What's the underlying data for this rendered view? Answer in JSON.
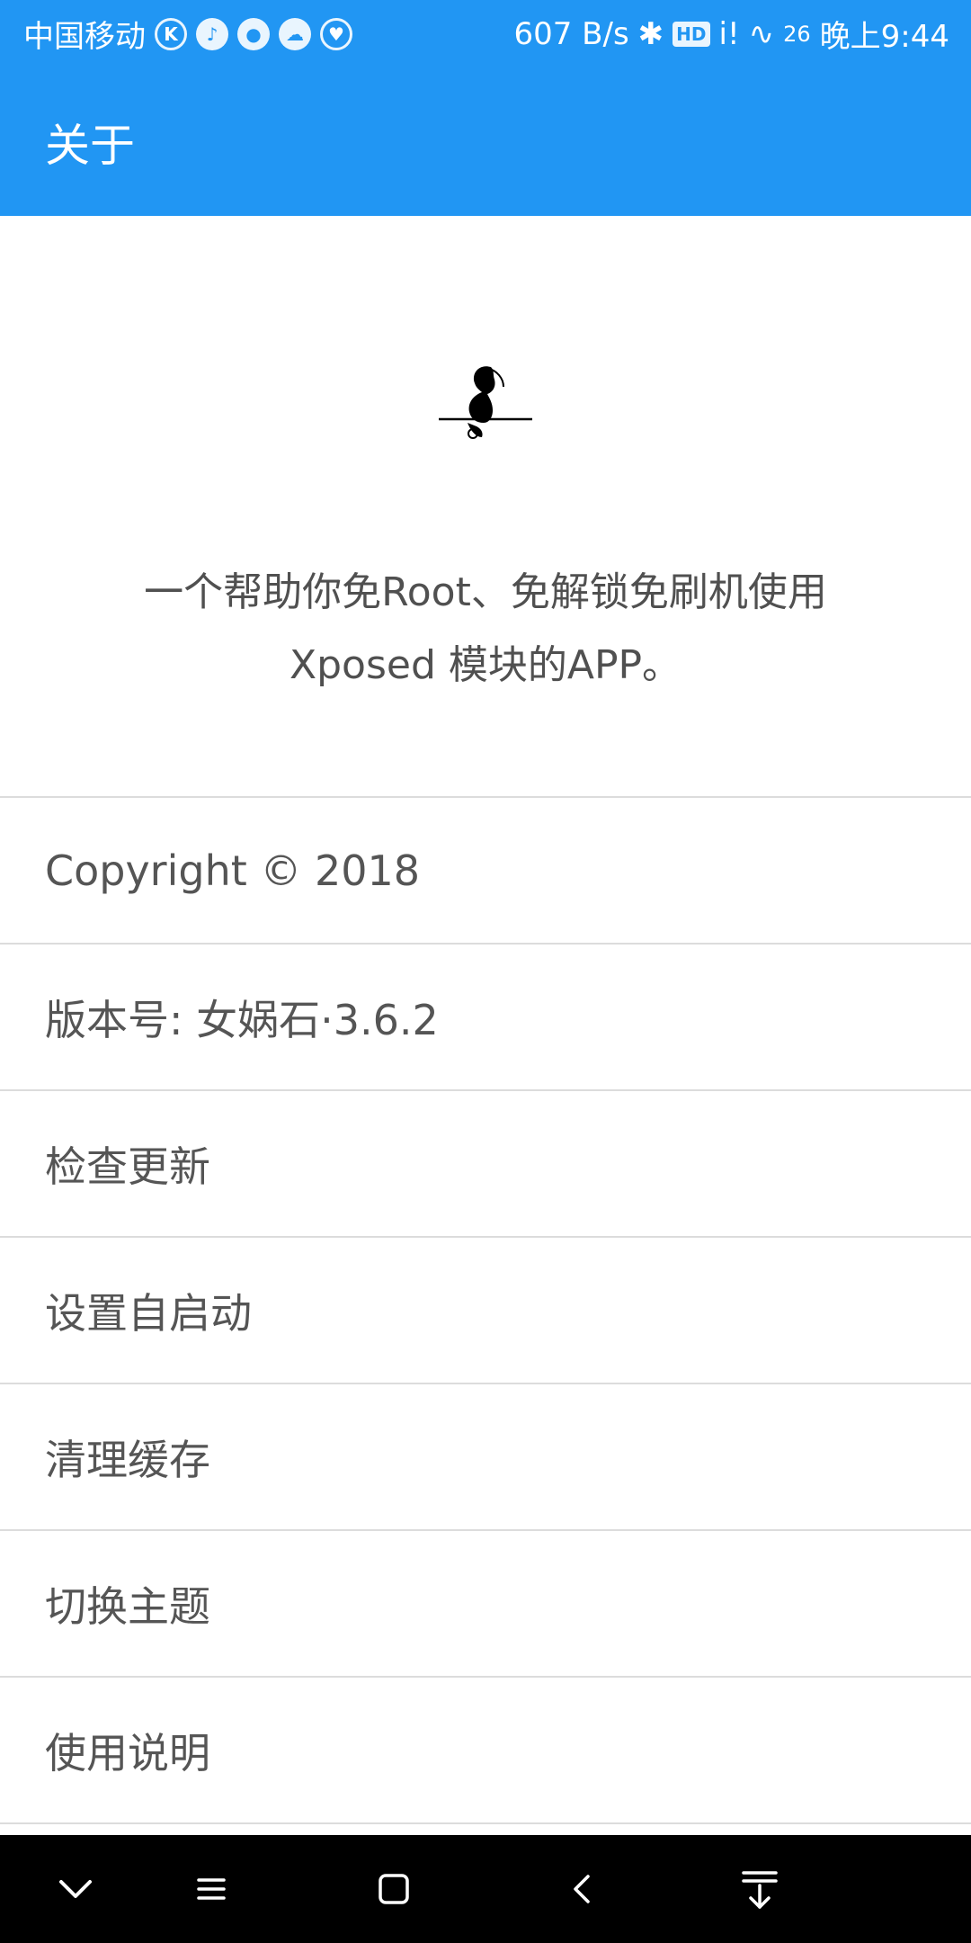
{
  "status_bar": {
    "carrier": "中国移动",
    "icons_left": [
      "k-app-icon",
      "music-app-icon",
      "browser-app-icon",
      "cloud-app-icon",
      "shield-app-icon"
    ],
    "net_speed": "607 B/s",
    "hd_badge": "HD",
    "signal": "i!",
    "battery": "26",
    "time": "晚上9:44"
  },
  "app_bar": {
    "title": "关于"
  },
  "header": {
    "description_line1": "一个帮助你免Root、免解锁免刷机使用",
    "description_line2": "Xposed 模块的APP。"
  },
  "list": {
    "items": [
      {
        "label": "Copyright © 2018"
      },
      {
        "label": "版本号: 女娲石·3.6.2"
      },
      {
        "label": "检查更新"
      },
      {
        "label": "设置自启动"
      },
      {
        "label": "清理缓存"
      },
      {
        "label": "切换主题"
      },
      {
        "label": "使用说明"
      }
    ]
  },
  "nav_bar": {
    "buttons": [
      "chevron-down-icon",
      "menu-icon",
      "home-square-icon",
      "back-icon",
      "pull-down-icon"
    ]
  },
  "colors": {
    "primary": "#2196f3",
    "text": "#555555",
    "divider": "#dcdcdc",
    "nav_bg": "#000000"
  }
}
